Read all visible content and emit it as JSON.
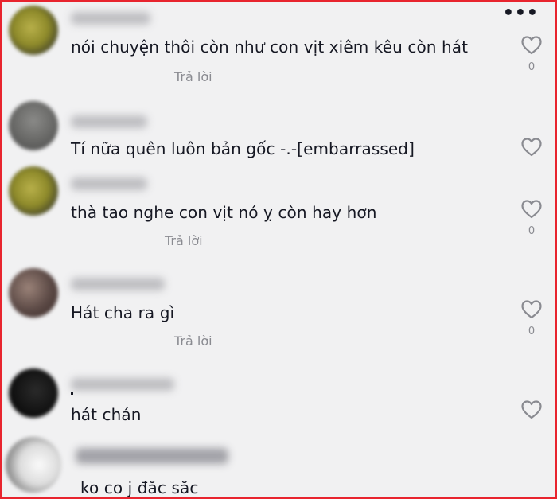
{
  "more_menu": {
    "icon": "more-options-icon",
    "glyph": "•••"
  },
  "comments": [
    {
      "text": "nói chuyện thôi còn như con vịt xiêm kêu còn hát",
      "reply_label": "Trả lời",
      "likes": "0"
    },
    {
      "text": "Tí nữa quên luôn bản gốc -.-[embarrassed]",
      "reply_label": "",
      "likes": ""
    },
    {
      "text": "thà tao nghe con vịt nó ỵ còn hay hơn",
      "reply_label": "Trả lời",
      "likes": "0"
    },
    {
      "text": "Hát cha ra gì",
      "reply_label": "Trả lời",
      "likes": "0"
    },
    {
      "text": "hát chán",
      "reply_label": "",
      "likes": ""
    },
    {
      "text": "ko co j đăc săc",
      "reply_label": "",
      "likes": ""
    }
  ],
  "colors": {
    "border": "#e8242e",
    "background": "#f1f1f2",
    "text": "#161823",
    "muted": "#8a8b91"
  }
}
